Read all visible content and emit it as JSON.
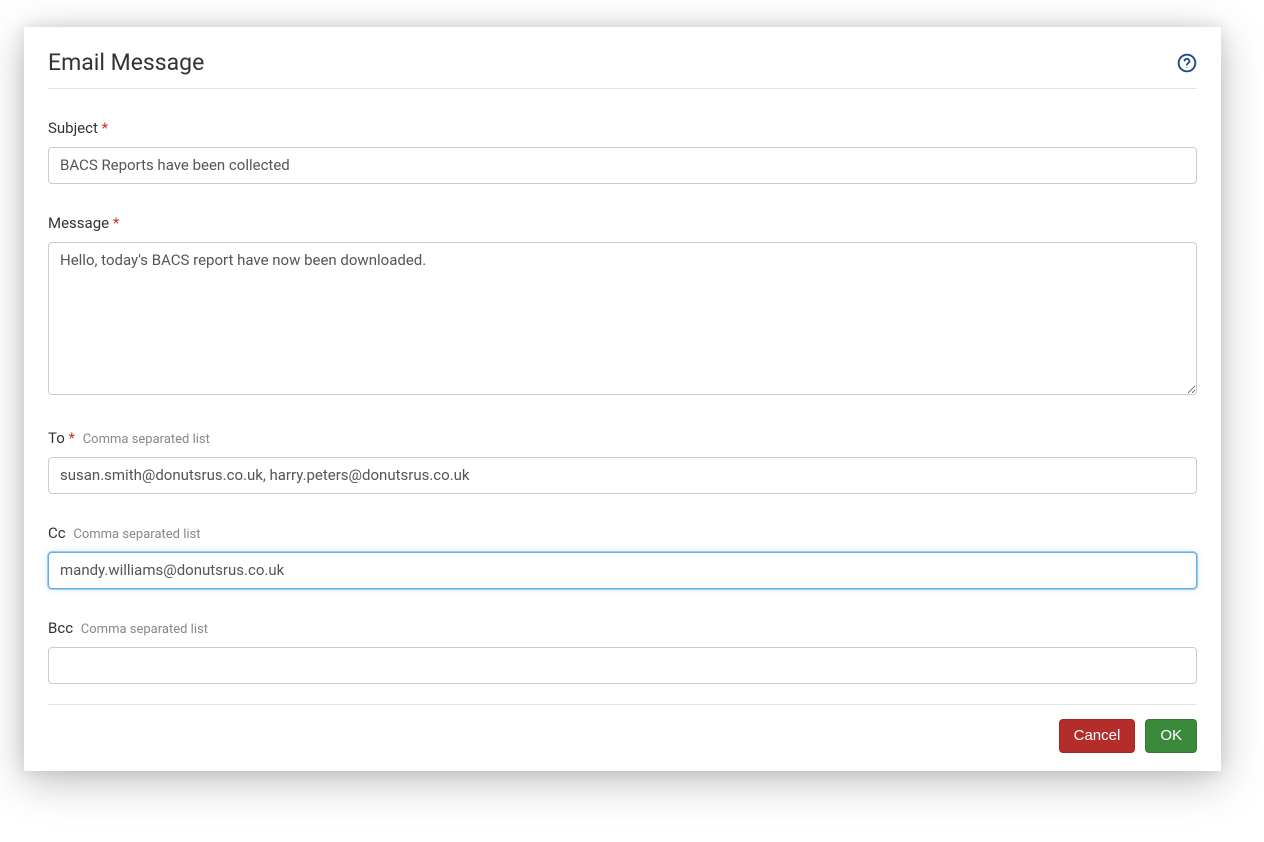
{
  "dialog": {
    "title": "Email Message"
  },
  "fields": {
    "subject": {
      "label": "Subject",
      "required": "*",
      "value": "BACS Reports have been collected"
    },
    "message": {
      "label": "Message",
      "required": "*",
      "value": "Hello, today's BACS report have now been downloaded."
    },
    "to": {
      "label": "To",
      "required": "*",
      "hint": "Comma separated list",
      "value": "susan.smith@donutsrus.co.uk, harry.peters@donutsrus.co.uk"
    },
    "cc": {
      "label": "Cc",
      "hint": "Comma separated list",
      "value": "mandy.williams@donutsrus.co.uk"
    },
    "bcc": {
      "label": "Bcc",
      "hint": "Comma separated list",
      "value": ""
    }
  },
  "buttons": {
    "cancel": "Cancel",
    "ok": "OK"
  }
}
